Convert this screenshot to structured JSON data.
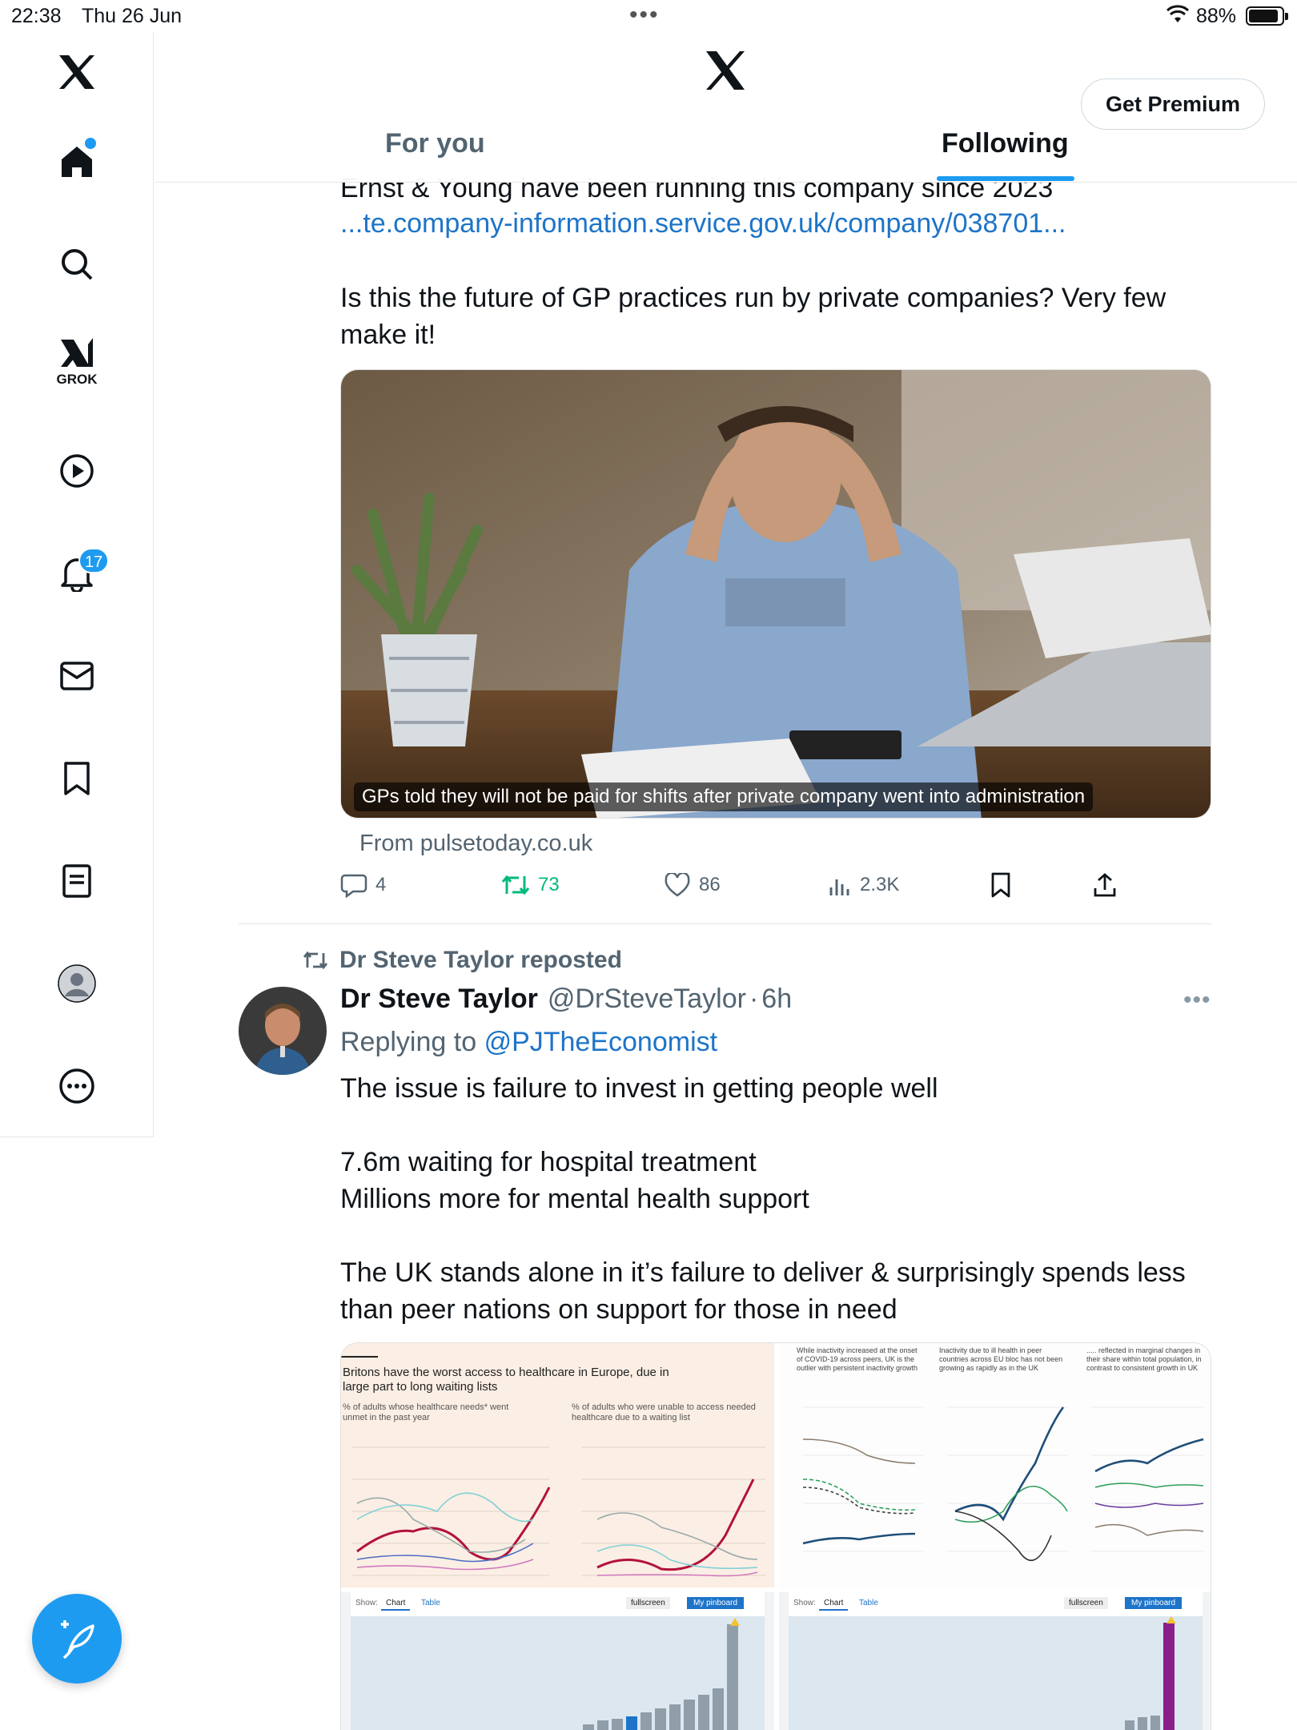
{
  "status_bar": {
    "time": "22:38",
    "date": "Thu 26 Jun",
    "battery": "88%",
    "battery_level": 0.88
  },
  "sidebar": {
    "notifications_count": "17",
    "grok_label": "GROK",
    "items": [
      "home-icon",
      "search-icon",
      "grok-icon",
      "video-icon",
      "notifications-icon",
      "messages-icon",
      "bookmarks-icon",
      "lists-icon",
      "profile-icon",
      "more-icon"
    ]
  },
  "header": {
    "premium_label": "Get Premium",
    "tabs": [
      {
        "label": "For you",
        "active": false
      },
      {
        "label": "Following",
        "active": true
      }
    ]
  },
  "tweet1": {
    "text_line_partial": "Ernst & Young have been running this company since 2023",
    "link": "...te.company-information.service.gov.uk/company/038701...",
    "body_line1": "Is this the future of GP practices run by private companies? Very few",
    "body_line2": "make it!",
    "card_caption": "GPs told they will not be paid for shifts after private company went into administration",
    "card_source": "From pulsetoday.co.uk",
    "replies": "4",
    "reposts": "73",
    "likes": "86",
    "views": "2.3K"
  },
  "tweet2": {
    "repost_label": "Dr Steve Taylor reposted",
    "name": "Dr Steve Taylor",
    "handle": "@DrSteveTaylor",
    "time": "6h",
    "replying_prefix": "Replying to",
    "replying_to": "@PJTheEconomist",
    "line1": "The issue is failure to invest in getting people well",
    "line2": "7.6m waiting for hospital treatment",
    "line3": "Millions more for mental health support",
    "line4": "The UK stands alone in it’s failure to deliver & surprisingly spends less",
    "line5": "than peer nations on support for those in need"
  },
  "media": {
    "chart1_title": "Britons have the worst access to healthcare in Europe, due in large part to long waiting lists",
    "chart1_sub_left": "% of adults whose healthcare needs* went unmet in the past year",
    "chart1_sub_right": "% of adults who were unable to access needed healthcare due to a waiting list",
    "chart2_head1": "While inactivity increased at the onset of COVID-19 across peers, UK is the outlier with persistent inactivity growth",
    "chart2_head2": "Inactivity due to ill health in peer countries across EU bloc has not been growing as rapidly as in the UK",
    "chart2_head3": "..... reflected in marginal changes in their share within total population, in contrast to consistent growth in UK",
    "panel_show": "Show:",
    "panel_chart": "Chart",
    "panel_table": "Table",
    "panel_fullscreen": "fullscreen",
    "panel_pinboard": "My pinboard"
  }
}
